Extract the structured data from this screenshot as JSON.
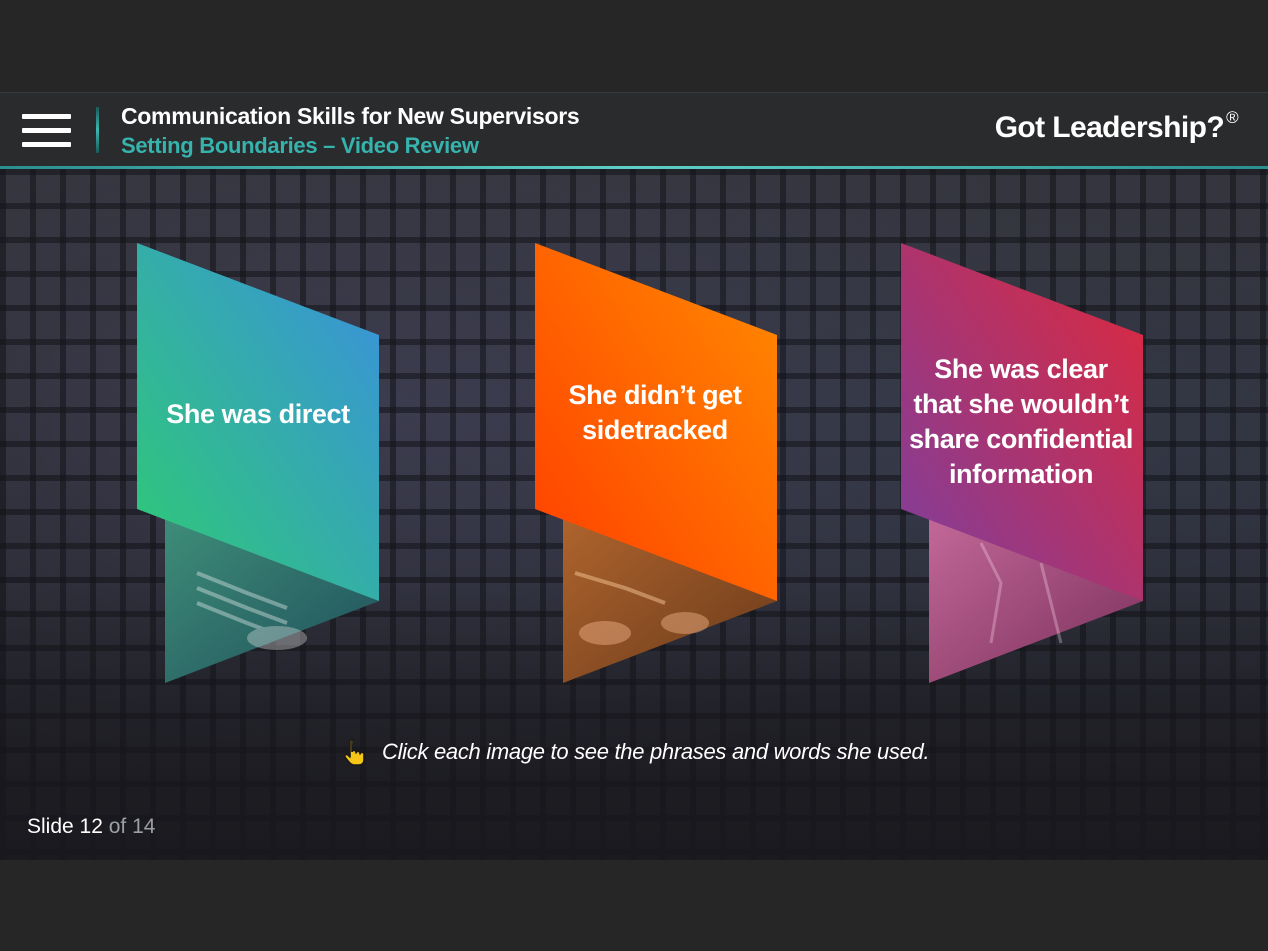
{
  "header": {
    "course_title": "Communication Skills for New Supervisors",
    "lesson_title": "Setting Boundaries – Video Review",
    "brand": "Got Leadership?",
    "brand_mark": "®",
    "accent_color": "#36b3ad"
  },
  "menu": {
    "icon": "hamburger-menu-icon"
  },
  "cards": [
    {
      "label": "She was direct",
      "gradient": [
        "#2ecc71",
        "#3a8fe0"
      ],
      "photo_tint": "#2e8b6f"
    },
    {
      "label": "She didn’t get sidetracked",
      "gradient": [
        "#ff3d00",
        "#ff8c00"
      ],
      "photo_tint": "#a0522d"
    },
    {
      "label": "She was clear that she wouldn’t share confidential information",
      "gradient": [
        "#7b3fa0",
        "#e0283a"
      ],
      "photo_tint": "#b04a78"
    }
  ],
  "hint": {
    "icon": "pointing-hand-icon",
    "text": "Click each image to see the phrases and words she used."
  },
  "footer": {
    "slide_label": "Slide 12",
    "slide_total": "of 14"
  }
}
